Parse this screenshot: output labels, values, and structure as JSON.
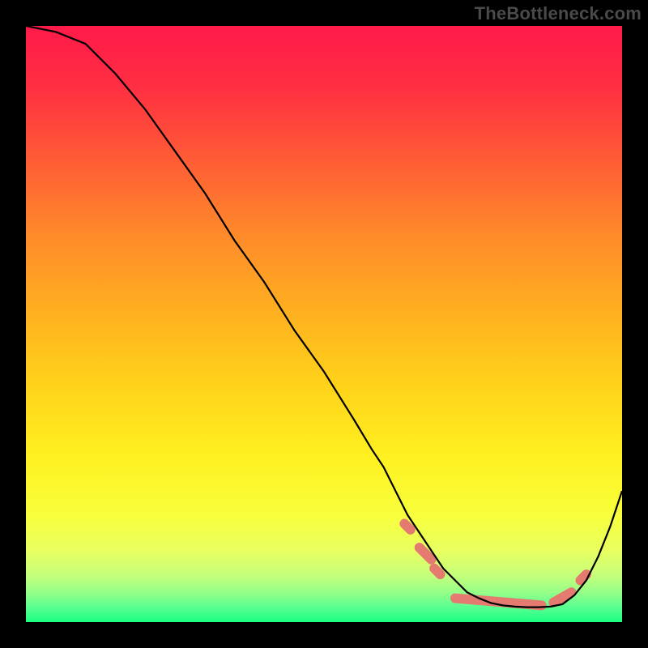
{
  "watermark": "TheBottleneck.com",
  "chart_data": {
    "type": "line",
    "title": "",
    "xlabel": "",
    "ylabel": "",
    "xlim": [
      0,
      100
    ],
    "ylim": [
      0,
      100
    ],
    "grid": false,
    "legend": false,
    "note": "x used as horizontal-percentage axis; y as percentage height — labels not printed in original image",
    "series": [
      {
        "name": "curve",
        "x": [
          0,
          5,
          10,
          15,
          20,
          25,
          30,
          35,
          40,
          45,
          50,
          55,
          58,
          60,
          62,
          64,
          66,
          68,
          70,
          72,
          74,
          76,
          78,
          80,
          82,
          84,
          86,
          88,
          90,
          92,
          94,
          96,
          98,
          100
        ],
        "y": [
          100,
          99,
          97,
          92,
          86,
          79,
          72,
          64,
          57,
          49,
          42,
          34,
          29,
          26,
          22,
          18,
          15,
          12,
          9,
          7,
          5,
          4,
          3.2,
          2.8,
          2.6,
          2.5,
          2.5,
          2.6,
          3,
          4.5,
          7,
          11,
          16,
          22
        ]
      }
    ],
    "segments": [
      {
        "name": "dot",
        "x0": 63.5,
        "y0": 16.5,
        "x1": 64.5,
        "y1": 15.5
      },
      {
        "name": "short1",
        "x0": 66.0,
        "y0": 12.5,
        "x1": 68.0,
        "y1": 10.5
      },
      {
        "name": "dot2",
        "x0": 68.5,
        "y0": 9.0,
        "x1": 69.5,
        "y1": 8.0
      },
      {
        "name": "flat",
        "x0": 72.0,
        "y0": 4.0,
        "x1": 86.5,
        "y1": 2.8
      },
      {
        "name": "rseg",
        "x0": 88.5,
        "y0": 3.3,
        "x1": 91.5,
        "y1": 5.0
      },
      {
        "name": "rdot",
        "x0": 93.0,
        "y0": 7.0,
        "x1": 94.0,
        "y1": 8.0
      }
    ],
    "gradient_stops": [
      {
        "offset": 0.0,
        "color": "#ff1a4a"
      },
      {
        "offset": 0.1,
        "color": "#ff2e42"
      },
      {
        "offset": 0.22,
        "color": "#ff5a36"
      },
      {
        "offset": 0.35,
        "color": "#ff8a2a"
      },
      {
        "offset": 0.48,
        "color": "#ffb020"
      },
      {
        "offset": 0.6,
        "color": "#ffd21a"
      },
      {
        "offset": 0.72,
        "color": "#fff020"
      },
      {
        "offset": 0.82,
        "color": "#f8ff3c"
      },
      {
        "offset": 0.88,
        "color": "#e8ff60"
      },
      {
        "offset": 0.92,
        "color": "#c7ff7a"
      },
      {
        "offset": 0.95,
        "color": "#96ff88"
      },
      {
        "offset": 0.975,
        "color": "#5aff92"
      },
      {
        "offset": 1.0,
        "color": "#1aff82"
      }
    ],
    "curve_stroke": "#000000",
    "segment_stroke": "#e47a70",
    "segment_width": 12
  }
}
